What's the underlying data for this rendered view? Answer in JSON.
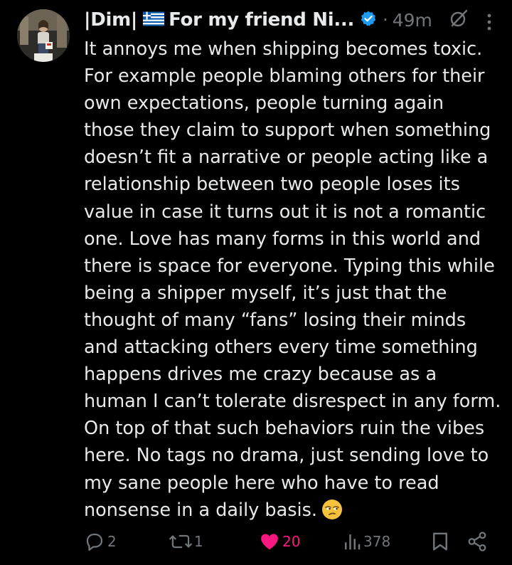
{
  "tweet": {
    "display_name": "|Dim|",
    "display_name_suffix": "For my friend Ni...",
    "time_separator": "·",
    "time": "49m",
    "text_lines": [
      "It annoys me when shipping becomes toxic.",
      "For example people blaming others for their",
      "own expectations, people turning again",
      "those they claim to support when something",
      "doesn’t fit a narrative or people acting like a",
      "relationship between two people loses its",
      "value in case it turns out it is not a romantic",
      "one. Love has many forms in this world and",
      "there is space for everyone. Typing this while",
      "being a shipper myself, it’s just that the",
      "thought of many “fans” losing their minds",
      "and attacking others every time something",
      "happens drives me crazy because as a",
      "human I can’t tolerate disrespect in any form.",
      "On top of that such behaviors ruin the vibes",
      "here. No tags no drama, just sending love to",
      "my sane people here who have to read",
      "nonsense in a daily basis."
    ],
    "emoji": "unamused-face-emoji",
    "flag": "greece-flag-icon"
  },
  "actions": {
    "replies": "2",
    "reposts": "1",
    "likes": "20",
    "views": "378"
  },
  "colors": {
    "background": "#000000",
    "text": "#e7e9ea",
    "muted": "#71767b",
    "verified": "#1d9bf0",
    "like": "#f91880"
  },
  "icons": [
    "reply-icon",
    "repost-icon",
    "heart-icon",
    "views-icon",
    "bookmark-icon",
    "share-icon",
    "grok-icon",
    "more-icon",
    "verified-icon"
  ]
}
